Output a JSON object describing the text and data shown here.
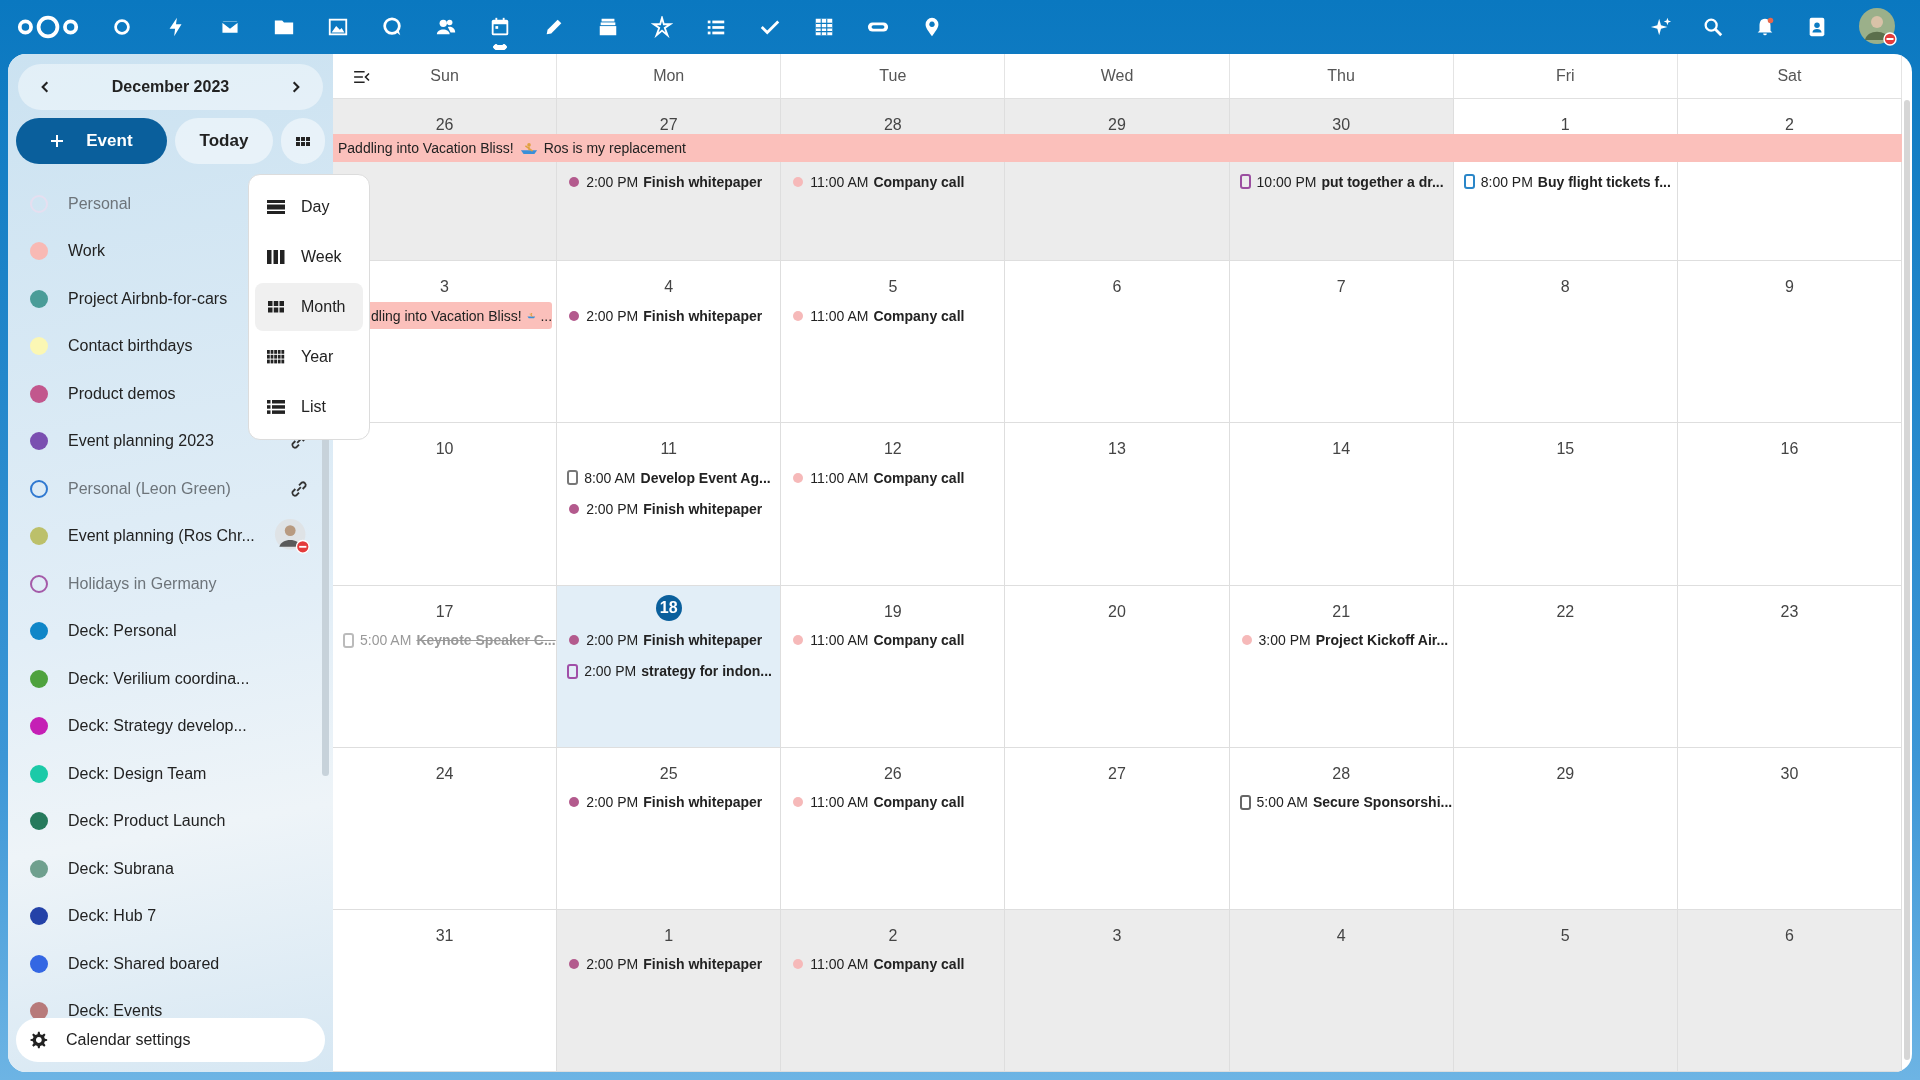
{
  "top_bar": {
    "apps": [
      {
        "selected": false
      },
      {
        "selected": false
      },
      {
        "selected": false
      },
      {
        "selected": false
      },
      {
        "selected": false
      },
      {
        "selected": false
      },
      {
        "selected": false
      },
      {
        "selected": true
      },
      {
        "selected": false
      },
      {
        "selected": false
      },
      {
        "selected": false
      },
      {
        "selected": false
      },
      {
        "selected": false
      },
      {
        "selected": false
      },
      {
        "selected": false
      },
      {
        "selected": false
      }
    ]
  },
  "sidebar": {
    "month": "December 2023",
    "new_event": "Event",
    "today": "Today",
    "view_menu": [
      {
        "label": "Day",
        "selected": false
      },
      {
        "label": "Week",
        "selected": false
      },
      {
        "label": "Month",
        "selected": true
      },
      {
        "label": "Year",
        "selected": false
      },
      {
        "label": "List",
        "selected": false
      }
    ],
    "calendars": [
      {
        "name": "Personal",
        "color": "#e6dff0",
        "enabled": false
      },
      {
        "name": "Work",
        "color": "#f8b9b4",
        "enabled": true
      },
      {
        "name": "Project Airbnb-for-cars",
        "color": "#4a9c98",
        "enabled": true
      },
      {
        "name": "Contact birthdays",
        "color": "#fbf7b4",
        "enabled": true
      },
      {
        "name": "Product demos",
        "color": "#c2578d",
        "enabled": true
      },
      {
        "name": "Event planning 2023",
        "color": "#7a4fb0",
        "enabled": true,
        "linked": true,
        "owner_avatar": false
      },
      {
        "name": "Personal (Leon Green)",
        "color": "#2f78d0",
        "enabled": false,
        "linked": true,
        "owner_avatar": false
      },
      {
        "name": "Event planning (Ros Chr...",
        "color": "#bcc06a",
        "enabled": true,
        "linked": false,
        "owner_avatar": true
      },
      {
        "name": "Holidays in Germany",
        "color": "#a45aa8",
        "enabled": false,
        "linked": false,
        "owner_avatar": false
      },
      {
        "name": "Deck: Personal",
        "color": "#0f86c8",
        "enabled": true,
        "linked": false,
        "owner_avatar": false
      },
      {
        "name": "Deck: Verilium coordina...",
        "color": "#4ea23e",
        "enabled": true,
        "linked": false,
        "owner_avatar": false
      },
      {
        "name": "Deck: Strategy develop...",
        "color": "#c51fb5",
        "enabled": true,
        "linked": false,
        "owner_avatar": false
      },
      {
        "name": "Deck: Design Team",
        "color": "#1bcaa8",
        "enabled": true,
        "linked": false,
        "owner_avatar": false
      },
      {
        "name": "Deck: Product Launch",
        "color": "#267a5c",
        "enabled": true,
        "linked": false,
        "owner_avatar": false
      },
      {
        "name": "Deck: Subrana",
        "color": "#6fa08e",
        "enabled": true,
        "linked": false,
        "owner_avatar": false
      },
      {
        "name": "Deck: Hub 7",
        "color": "#2442a8",
        "enabled": true,
        "linked": false,
        "owner_avatar": false
      },
      {
        "name": "Deck: Shared boared",
        "color": "#3467e3",
        "enabled": true,
        "linked": false,
        "owner_avatar": false
      },
      {
        "name": "Deck: Events",
        "color": "#b77a7a",
        "enabled": true,
        "linked": false,
        "owner_avatar": false
      }
    ],
    "settings": "Calendar settings"
  },
  "calendar": {
    "weekdays": [
      "Sun",
      "Mon",
      "Tue",
      "Wed",
      "Thu",
      "Fri",
      "Sat"
    ],
    "weeks": [
      {
        "banner": {
          "text": "Paddling into Vacation Bliss!",
          "after": "Ros is my replacement",
          "color": "#fbc0bb"
        },
        "days": [
          {
            "date": "26",
            "other_month": true,
            "today": false
          },
          {
            "date": "27",
            "other_month": true,
            "today": false,
            "events": [
              {
                "kind": "dot",
                "time": "2:00 PM",
                "title": "Finish whitepaper",
                "color": "#b35a8d"
              }
            ]
          },
          {
            "date": "28",
            "other_month": true,
            "today": false,
            "events": [
              {
                "kind": "dot",
                "time": "11:00 AM",
                "title": "Company call",
                "color": "#f6b9b9"
              }
            ]
          },
          {
            "date": "29",
            "other_month": true,
            "today": false
          },
          {
            "date": "30",
            "other_month": true,
            "today": false,
            "events": [
              {
                "kind": "task",
                "time": "10:00 PM",
                "title": "put together a dr...",
                "color": "#9b4fa0",
                "done": false
              }
            ]
          },
          {
            "date": "1",
            "other_month": false,
            "today": false,
            "events": [
              {
                "kind": "task",
                "time": "8:00 PM",
                "title": "Buy flight tickets f...",
                "color": "#2a86c8",
                "done": false
              }
            ]
          },
          {
            "date": "2",
            "other_month": false,
            "today": false
          }
        ]
      },
      {
        "days": [
          {
            "date": "3",
            "other_month": false,
            "today": false,
            "events": [
              {
                "kind": "allday",
                "title": "dling into Vacation Bliss!",
                "after": "...",
                "color": "#fbc0bb"
              }
            ]
          },
          {
            "date": "4",
            "other_month": false,
            "today": false,
            "events": [
              {
                "kind": "dot",
                "time": "2:00 PM",
                "title": "Finish whitepaper",
                "color": "#b35a8d"
              }
            ]
          },
          {
            "date": "5",
            "other_month": false,
            "today": false,
            "events": [
              {
                "kind": "dot",
                "time": "11:00 AM",
                "title": "Company call",
                "color": "#f6b9b9"
              }
            ]
          },
          {
            "date": "6",
            "other_month": false,
            "today": false
          },
          {
            "date": "7",
            "other_month": false,
            "today": false
          },
          {
            "date": "8",
            "other_month": false,
            "today": false
          },
          {
            "date": "9",
            "other_month": false,
            "today": false
          }
        ]
      },
      {
        "days": [
          {
            "date": "10",
            "other_month": false,
            "today": false
          },
          {
            "date": "11",
            "other_month": false,
            "today": false,
            "events": [
              {
                "kind": "task",
                "time": "8:00 AM",
                "title": "Develop Event Ag...",
                "color": "#777777",
                "done": false
              },
              {
                "kind": "dot",
                "time": "2:00 PM",
                "title": "Finish whitepaper",
                "color": "#b35a8d"
              }
            ]
          },
          {
            "date": "12",
            "other_month": false,
            "today": false,
            "events": [
              {
                "kind": "dot",
                "time": "11:00 AM",
                "title": "Company call",
                "color": "#f6b9b9"
              }
            ]
          },
          {
            "date": "13",
            "other_month": false,
            "today": false
          },
          {
            "date": "14",
            "other_month": false,
            "today": false
          },
          {
            "date": "15",
            "other_month": false,
            "today": false
          },
          {
            "date": "16",
            "other_month": false,
            "today": false
          }
        ]
      },
      {
        "days": [
          {
            "date": "17",
            "other_month": false,
            "today": false,
            "events": [
              {
                "kind": "task",
                "time": "5:00 AM",
                "title": "Keynote Speaker C...",
                "color": "#bbbbbb",
                "done": true
              }
            ]
          },
          {
            "date": "18",
            "other_month": false,
            "today": true,
            "events": [
              {
                "kind": "dot",
                "time": "2:00 PM",
                "title": "Finish whitepaper",
                "color": "#b35a8d"
              },
              {
                "kind": "task",
                "time": "2:00 PM",
                "title": "strategy for indon...",
                "color": "#a04fa8",
                "done": false
              }
            ]
          },
          {
            "date": "19",
            "other_month": false,
            "today": false,
            "events": [
              {
                "kind": "dot",
                "time": "11:00 AM",
                "title": "Company call",
                "color": "#f6b9b9"
              }
            ]
          },
          {
            "date": "20",
            "other_month": false,
            "today": false
          },
          {
            "date": "21",
            "other_month": false,
            "today": false,
            "events": [
              {
                "kind": "dot",
                "time": "3:00 PM",
                "title": "Project Kickoff Air...",
                "color": "#f6b9b9"
              }
            ]
          },
          {
            "date": "22",
            "other_month": false,
            "today": false
          },
          {
            "date": "23",
            "other_month": false,
            "today": false
          }
        ]
      },
      {
        "days": [
          {
            "date": "24",
            "other_month": false,
            "today": false
          },
          {
            "date": "25",
            "other_month": false,
            "today": false,
            "events": [
              {
                "kind": "dot",
                "time": "2:00 PM",
                "title": "Finish whitepaper",
                "color": "#b35a8d"
              }
            ]
          },
          {
            "date": "26",
            "other_month": false,
            "today": false,
            "events": [
              {
                "kind": "dot",
                "time": "11:00 AM",
                "title": "Company call",
                "color": "#f6b9b9"
              }
            ]
          },
          {
            "date": "27",
            "other_month": false,
            "today": false
          },
          {
            "date": "28",
            "other_month": false,
            "today": false,
            "events": [
              {
                "kind": "task",
                "time": "5:00 AM",
                "title": "Secure Sponsorshi...",
                "color": "#666666",
                "done": false
              }
            ]
          },
          {
            "date": "29",
            "other_month": false,
            "today": false
          },
          {
            "date": "30",
            "other_month": false,
            "today": false
          }
        ]
      },
      {
        "days": [
          {
            "date": "31",
            "other_month": false,
            "today": false
          },
          {
            "date": "1",
            "other_month": true,
            "today": false,
            "events": [
              {
                "kind": "dot",
                "time": "2:00 PM",
                "title": "Finish whitepaper",
                "color": "#b35a8d"
              }
            ]
          },
          {
            "date": "2",
            "other_month": true,
            "today": false,
            "events": [
              {
                "kind": "dot",
                "time": "11:00 AM",
                "title": "Company call",
                "color": "#f6b9b9"
              }
            ]
          },
          {
            "date": "3",
            "other_month": true,
            "today": false
          },
          {
            "date": "4",
            "other_month": true,
            "today": false
          },
          {
            "date": "5",
            "other_month": true,
            "today": false
          },
          {
            "date": "6",
            "other_month": true,
            "today": false
          }
        ]
      }
    ]
  }
}
